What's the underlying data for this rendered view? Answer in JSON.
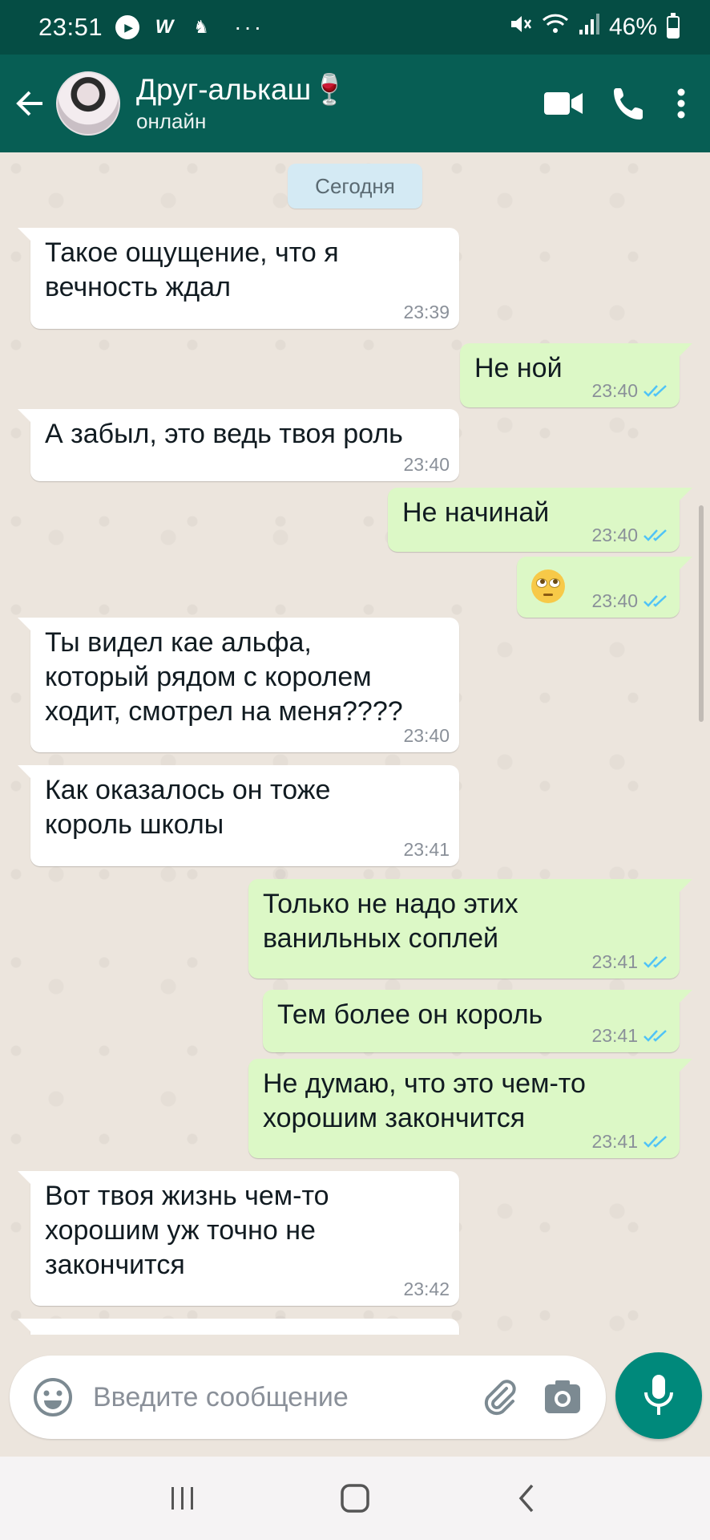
{
  "status_bar": {
    "time": "23:51",
    "icons": [
      "play-icon",
      "w-icon",
      "notification-icon"
    ],
    "more": "···",
    "battery": "46%",
    "battery_level": 0.46
  },
  "header": {
    "contact_name": "Друг-алькаш🍷",
    "contact_status": "онлайн",
    "actions": [
      "video-call-icon",
      "phone-icon",
      "more-vert-icon"
    ]
  },
  "chat": {
    "date_label": "Сегодня",
    "messages": [
      {
        "dir": "in",
        "text": "Такое ощущение, что я\nвечность ждал",
        "time": "23:39"
      },
      {
        "dir": "out",
        "text": "Не ной",
        "time": "23:40"
      },
      {
        "dir": "in",
        "text": "А забыл, это ведь твоя роль",
        "time": "23:40"
      },
      {
        "dir": "out",
        "text": "Не начинай",
        "time": "23:40"
      },
      {
        "dir": "out",
        "text": "🙄",
        "time": "23:40"
      },
      {
        "dir": "in",
        "text": "Ты видел кае альфа,\nкоторый рядом с королем\nходит, смотрел на меня????",
        "time": "23:40"
      },
      {
        "dir": "in",
        "text": "Как оказалось он тоже\nкороль школы",
        "time": "23:41"
      },
      {
        "dir": "out",
        "text": "Только не надо этих\nванильных соплей",
        "time": "23:41"
      },
      {
        "dir": "out",
        "text": "Тем более он король",
        "time": "23:41"
      },
      {
        "dir": "out",
        "text": "Не думаю, что это чем-то\nхорошим закончится",
        "time": "23:41"
      },
      {
        "dir": "in",
        "text": "Вот твоя жизнь чем-то\nхорошим уж точно не\nзакончится",
        "time": "23:42"
      }
    ]
  },
  "composer": {
    "placeholder": "Введите сообщение",
    "value": ""
  },
  "colors": {
    "header": "#075e54",
    "status_bar": "#054d44",
    "incoming": "#ffffff",
    "outgoing": "#dcf8c6",
    "read_ticks": "#4fc3f7",
    "mic": "#00897b"
  }
}
